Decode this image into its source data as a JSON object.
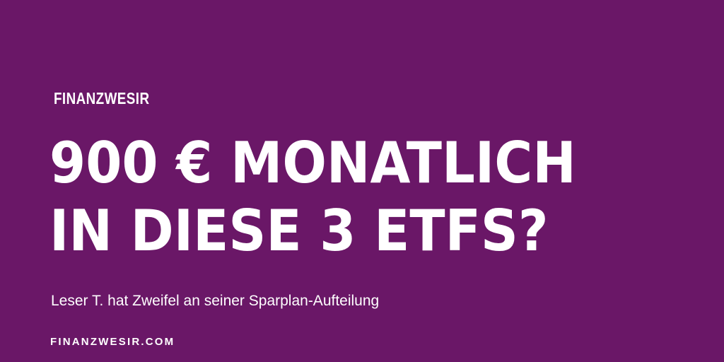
{
  "colors": {
    "background": "#6a1767",
    "text": "#ffffff"
  },
  "brand": "FINANZWESIR",
  "headline": {
    "line1": "900 € MONATLICH",
    "line2": "IN DIESE 3 ETFS?"
  },
  "subtitle": "Leser T. hat Zweifel an seiner Sparplan-Aufteilung",
  "url": "FINANZWESIR.COM"
}
